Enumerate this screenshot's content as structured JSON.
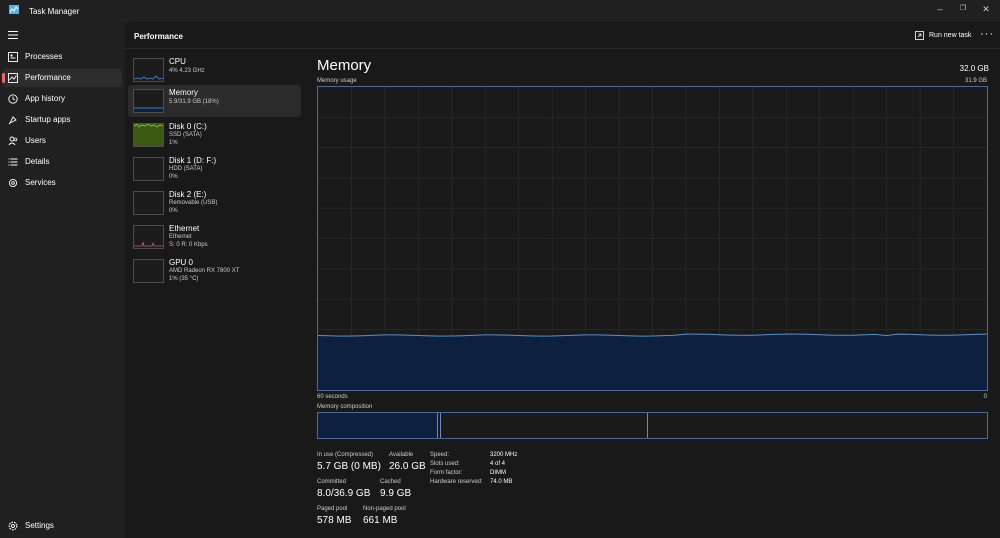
{
  "window": {
    "title": "Task Manager",
    "controls": {
      "minimize": "–",
      "restore": "❐",
      "close": "✕"
    }
  },
  "sidebar": {
    "items": [
      {
        "label": "Processes",
        "icon": "processes-icon"
      },
      {
        "label": "Performance",
        "icon": "performance-icon",
        "active": true
      },
      {
        "label": "App history",
        "icon": "history-icon"
      },
      {
        "label": "Startup apps",
        "icon": "startup-icon"
      },
      {
        "label": "Users",
        "icon": "users-icon"
      },
      {
        "label": "Details",
        "icon": "details-icon"
      },
      {
        "label": "Services",
        "icon": "services-icon"
      }
    ],
    "settings_label": "Settings"
  },
  "header": {
    "title": "Performance",
    "run_new_task": "Run new task",
    "more": "···"
  },
  "devices": [
    {
      "title": "CPU",
      "lines": [
        "4% 4.23 GHz"
      ]
    },
    {
      "title": "Memory",
      "lines": [
        "5.9/31.9 GB (18%)"
      ],
      "active": true
    },
    {
      "title": "Disk 0 (C:)",
      "lines": [
        "SSD (SATA)",
        "1%"
      ]
    },
    {
      "title": "Disk 1 (D: F:)",
      "lines": [
        "HDD (SATA)",
        "0%"
      ]
    },
    {
      "title": "Disk 2 (E:)",
      "lines": [
        "Removable (USB)",
        "0%"
      ]
    },
    {
      "title": "Ethernet",
      "lines": [
        "Ethernet",
        "S: 0 R: 0 Kbps"
      ]
    },
    {
      "title": "GPU 0",
      "lines": [
        "AMD Radeon RX 7800 XT",
        "1% (35 °C)"
      ]
    }
  ],
  "memory": {
    "title": "Memory",
    "total": "32.0 GB",
    "usage_label": "Memory usage",
    "max_label": "31.9 GB",
    "time_left": "60 seconds",
    "time_right": "0",
    "composition_label": "Memory composition",
    "usage_fraction": 0.18,
    "stats": {
      "in_use_label": "In use (Compressed)",
      "in_use_value": "5.7 GB (0 MB)",
      "available_label": "Available",
      "available_value": "26.0 GB",
      "committed_label": "Committed",
      "committed_value": "8.0/36.9 GB",
      "cached_label": "Cached",
      "cached_value": "9.9 GB",
      "paged_pool_label": "Paged pool",
      "paged_pool_value": "578 MB",
      "non_paged_pool_label": "Non-paged pool",
      "non_paged_pool_value": "661 MB"
    },
    "specs": {
      "speed_label": "Speed:",
      "speed_value": "3200 MHz",
      "slots_label": "Slots used:",
      "slots_value": "4 of 4",
      "form_label": "Form factor:",
      "form_value": "DIMM",
      "reserved_label": "Hardware reserved:",
      "reserved_value": "74.0 MB"
    },
    "composition": {
      "in_use_fraction": 0.178,
      "modified_fraction": 0.006,
      "standby_fraction": 0.31,
      "free_fraction": 0.506
    }
  },
  "colors": {
    "accent": "#4a8ad8",
    "memory_fill": "#0e2040",
    "memory_line": "#5a8fd0",
    "disk_fill": "#3d5a12",
    "disk_line": "#8bc34a",
    "ethernet_line": "#c95a7a",
    "active_indicator": "#e86767"
  }
}
